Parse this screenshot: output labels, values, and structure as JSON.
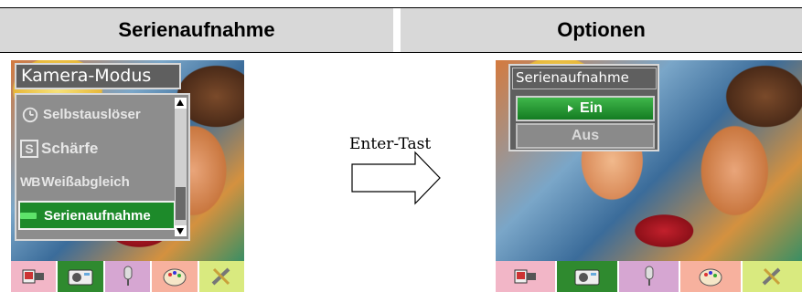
{
  "header": {
    "left_title": "Serienaufnahme",
    "right_title": "Optionen"
  },
  "left_screen": {
    "menu_title": "Kamera-Modus",
    "items": [
      {
        "icon": "timer-icon",
        "icon_text": "",
        "label": "Selbstauslöser"
      },
      {
        "icon": "sharpness-icon",
        "icon_text": "S",
        "label": "Schärfe"
      },
      {
        "icon": "white-balance-icon",
        "icon_text": "WB",
        "label": "Weißabgleich"
      },
      {
        "icon": "burst-icon",
        "icon_text": "",
        "label": "Serienaufnahme",
        "selected": true
      }
    ]
  },
  "arrow": {
    "label": "Enter-Tast"
  },
  "right_screen": {
    "menu_title": "Serienaufnahme",
    "options": [
      {
        "label": "Ein",
        "selected": true
      },
      {
        "label": "Aus",
        "selected": false
      }
    ]
  },
  "iconbar": {
    "tabs": [
      "video-mode-icon",
      "camera-mode-icon",
      "audio-mode-icon",
      "effects-palette-icon",
      "settings-tools-icon"
    ],
    "active_tab": "camera-mode-icon",
    "colors": [
      "#f2b6c7",
      "#2f8a2f",
      "#d6a6d2",
      "#f7b19e",
      "#d9ea7f"
    ]
  }
}
